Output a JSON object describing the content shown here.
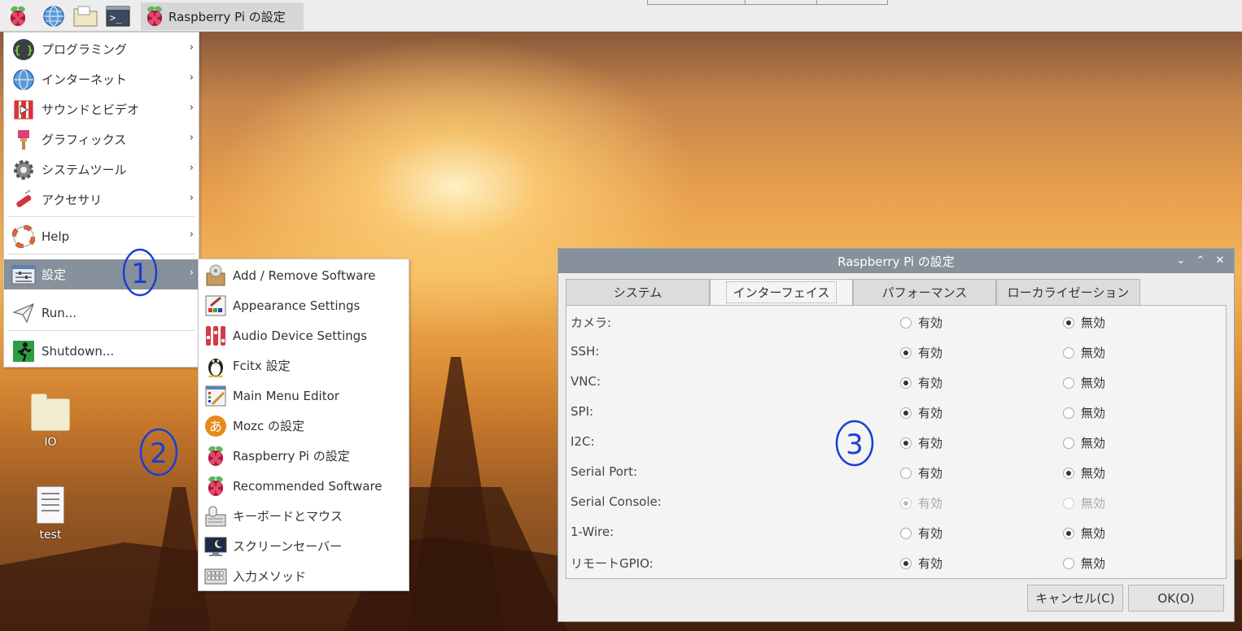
{
  "panel": {
    "task_title": "Raspberry Pi の設定",
    "launchers": [
      "raspberry-menu-icon",
      "web-browser-icon",
      "file-manager-icon",
      "terminal-icon"
    ]
  },
  "main_menu": {
    "items": [
      {
        "label": "プログラミング",
        "icon": "programming-icon"
      },
      {
        "label": "インターネット",
        "icon": "internet-icon"
      },
      {
        "label": "サウンドとビデオ",
        "icon": "sound-video-icon"
      },
      {
        "label": "グラフィックス",
        "icon": "graphics-icon"
      },
      {
        "label": "システムツール",
        "icon": "system-tools-icon"
      },
      {
        "label": "アクセサリ",
        "icon": "accessories-icon"
      },
      {
        "label": "Help",
        "icon": "help-icon"
      },
      {
        "label": "設定",
        "icon": "preferences-icon"
      },
      {
        "label": "Run...",
        "icon": "run-icon"
      },
      {
        "label": "Shutdown...",
        "icon": "shutdown-icon"
      }
    ]
  },
  "sub_menu": {
    "items": [
      {
        "label": "Add / Remove Software",
        "icon": "package-icon"
      },
      {
        "label": "Appearance Settings",
        "icon": "appearance-icon"
      },
      {
        "label": "Audio Device Settings",
        "icon": "audio-mixer-icon"
      },
      {
        "label": "Fcitx 設定",
        "icon": "penguin-icon"
      },
      {
        "label": "Main Menu Editor",
        "icon": "menu-editor-icon"
      },
      {
        "label": "Mozc の設定",
        "icon": "mozc-icon"
      },
      {
        "label": "Raspberry Pi の設定",
        "icon": "raspberry-icon"
      },
      {
        "label": "Recommended Software",
        "icon": "raspberry-icon"
      },
      {
        "label": "キーボードとマウス",
        "icon": "keyboard-mouse-icon"
      },
      {
        "label": "スクリーンセーバー",
        "icon": "screensaver-icon"
      },
      {
        "label": "入力メソッド",
        "icon": "input-method-icon"
      }
    ]
  },
  "desktop_icons": [
    {
      "label": "IO",
      "icon": "folder-icon"
    },
    {
      "label": "test",
      "icon": "text-file-icon"
    }
  ],
  "dialog": {
    "title": "Raspberry Pi の設定",
    "tabs": [
      "システム",
      "インターフェイス",
      "パフォーマンス",
      "ローカライゼーション"
    ],
    "active_tab": 1,
    "enable_label": "有効",
    "disable_label": "無効",
    "rows": [
      {
        "label": "カメラ:",
        "enabled": false,
        "disabled": false
      },
      {
        "label": "SSH:",
        "enabled": true,
        "disabled": false
      },
      {
        "label": "VNC:",
        "enabled": true,
        "disabled": false
      },
      {
        "label": "SPI:",
        "enabled": true,
        "disabled": false
      },
      {
        "label": "I2C:",
        "enabled": true,
        "disabled": false
      },
      {
        "label": "Serial Port:",
        "enabled": false,
        "disabled": false
      },
      {
        "label": "Serial Console:",
        "enabled": true,
        "disabled": true
      },
      {
        "label": "1-Wire:",
        "enabled": false,
        "disabled": false
      },
      {
        "label": "リモートGPIO:",
        "enabled": true,
        "disabled": false
      }
    ],
    "cancel_label": "キャンセル(C)",
    "ok_label": "OK(O)"
  },
  "annotations": [
    "1",
    "2",
    "3"
  ],
  "colors": {
    "menu_highlight": "#87919c",
    "annotation": "#1a3fd6"
  }
}
